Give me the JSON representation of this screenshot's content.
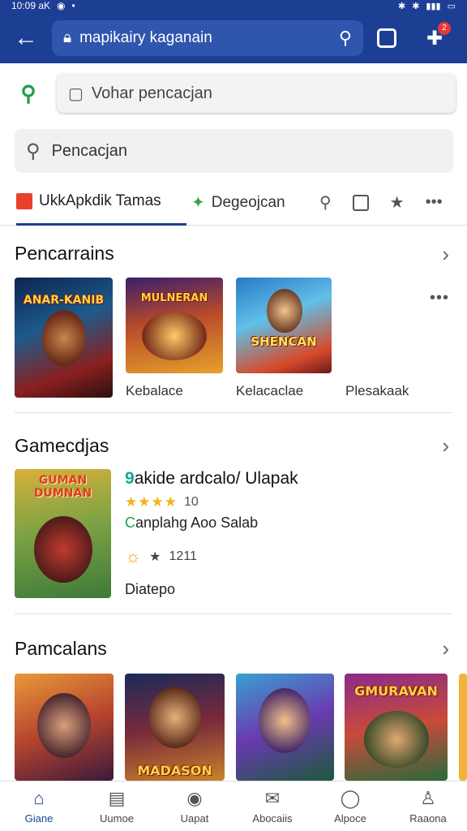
{
  "status_bar": {
    "time": "10:09 aK",
    "battery": ""
  },
  "browser": {
    "url": "mapikairy kaganain",
    "tab_count": "",
    "notif": "2"
  },
  "search": {
    "primary_placeholder": "Vohar pencacjan",
    "secondary_placeholder": "Pencacjan"
  },
  "tabs": [
    {
      "label": "UkkApkdik Tamas"
    },
    {
      "label": "Degeojcan"
    }
  ],
  "sections": {
    "first": {
      "title": "Pencarrains",
      "items": [
        {
          "art": "ANAR-KANIB",
          "label": ""
        },
        {
          "art": "MULNERAN",
          "label": "Kebalace"
        },
        {
          "art": "SHENCAN",
          "label": "Kelacaclae"
        },
        {
          "art": "",
          "label": "Plesakaak"
        }
      ]
    },
    "second": {
      "title": "Gamecdjas",
      "featured": {
        "art": "GUMAN DUMNAN",
        "number": "9",
        "title": "akide ardcalo/ Ulapak",
        "rating_stars": "★★★★",
        "rating_value": "10",
        "developer_prefix": "C",
        "developer_rest": "anplahg Aoo Salab",
        "meta_value": "1211",
        "status": "Diatepo"
      }
    },
    "third": {
      "title": "Pamcalans",
      "items": [
        {
          "art": ""
        },
        {
          "art": "MADASON"
        },
        {
          "art": ""
        },
        {
          "art": "GMURAVAN"
        }
      ]
    }
  },
  "bottom_nav": [
    {
      "label": "Giane",
      "icon": "home-icon"
    },
    {
      "label": "Uumoe",
      "icon": "store-icon"
    },
    {
      "label": "Uapat",
      "icon": "chevron-circle-icon"
    },
    {
      "label": "Abocaiis",
      "icon": "envelope-icon"
    },
    {
      "label": "Alpoce",
      "icon": "chat-icon"
    },
    {
      "label": "Raaona",
      "icon": "user-icon"
    }
  ],
  "colors": {
    "accent": "#1c3f94",
    "green": "#1e9e4a",
    "star": "#f1b31c"
  }
}
